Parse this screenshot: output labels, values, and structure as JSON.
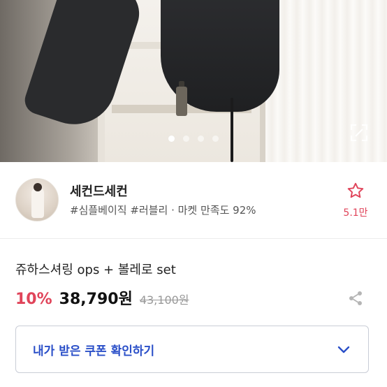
{
  "gallery": {
    "dots": [
      true,
      false,
      false,
      false
    ],
    "expand_icon": "expand-icon"
  },
  "seller": {
    "name": "세컨드세컨",
    "tags": "#심플베이직 #러블리 · 마켓 만족도 92%",
    "favorite_count": "5.1만",
    "accent_color": "#e0445a"
  },
  "product": {
    "title": "쥬하스셔링 ops + 볼레로 set",
    "discount": "10%",
    "price": "38,790원",
    "original_price": "43,100원"
  },
  "coupon": {
    "label": "내가 받은 쿠폰 확인하기",
    "color": "#2a4fc8"
  }
}
